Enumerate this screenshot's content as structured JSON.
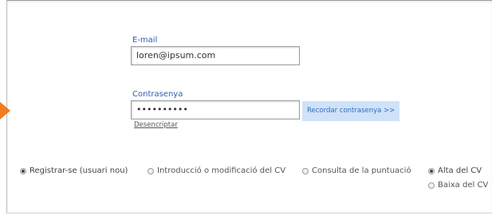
{
  "login": {
    "email_label": "E-mail",
    "email_value": "loren@ipsum.com",
    "password_label": "Contrasenya",
    "password_value": "••••••••••",
    "remember_button": "Recordar contrasenya >>",
    "decrypt_link": "Desencriptar"
  },
  "modes": {
    "register": "Registrar-se (usuari nou)",
    "introduce": "Introducció o modificació del CV",
    "consult": "Consulta de la puntuació",
    "selected": "register"
  },
  "cv_action": {
    "alta": "Alta del CV",
    "baixa": "Baixa del CV",
    "selected": "alta"
  },
  "colors": {
    "accent": "#2a5db0",
    "arrow": "#f07d1e",
    "button_bg": "#cfe2f8"
  }
}
